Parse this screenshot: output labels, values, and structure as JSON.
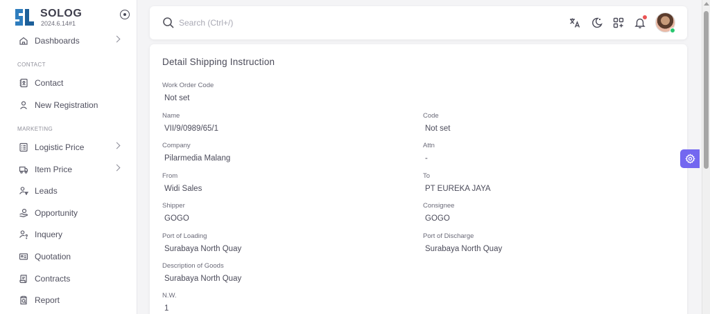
{
  "brand": {
    "name": "SOLOG",
    "version": "2024.6.14#1",
    "logo_text": "SL"
  },
  "sidebar": {
    "items": [
      {
        "key": "dashboards",
        "label": "Dashboards",
        "icon": "home-icon",
        "has_submenu": true
      },
      {
        "key": "contact",
        "label": "Contact",
        "icon": "contact-book-icon",
        "has_submenu": false
      },
      {
        "key": "new-registration",
        "label": "New Registration",
        "icon": "user-icon",
        "has_submenu": false
      },
      {
        "key": "logistic-price",
        "label": "Logistic Price",
        "icon": "list-icon",
        "has_submenu": true
      },
      {
        "key": "item-price",
        "label": "Item Price",
        "icon": "truck-icon",
        "has_submenu": true
      },
      {
        "key": "leads",
        "label": "Leads",
        "icon": "user-filter-icon",
        "has_submenu": false
      },
      {
        "key": "opportunity",
        "label": "Opportunity",
        "icon": "hand-coin-icon",
        "has_submenu": false
      },
      {
        "key": "inquery",
        "label": "Inquery",
        "icon": "user-question-icon",
        "has_submenu": false
      },
      {
        "key": "quotation",
        "label": "Quotation",
        "icon": "id-card-icon",
        "has_submenu": false
      },
      {
        "key": "contracts",
        "label": "Contracts",
        "icon": "scroll-icon",
        "has_submenu": false
      },
      {
        "key": "report",
        "label": "Report",
        "icon": "report-icon",
        "has_submenu": false
      }
    ],
    "sections": {
      "contact": "CONTACT",
      "marketing": "MARKETING"
    }
  },
  "header": {
    "search_placeholder": "Search (Ctrl+/)",
    "icons": [
      "translate-icon",
      "moon-icon",
      "apps-add-icon",
      "bell-icon"
    ]
  },
  "detail": {
    "title": "Detail Shipping Instruction",
    "fields": {
      "work_order_code": {
        "label": "Work Order Code",
        "value": "Not set"
      },
      "name": {
        "label": "Name",
        "value": "VII/9/0989/65/1"
      },
      "code": {
        "label": "Code",
        "value": "Not set"
      },
      "company": {
        "label": "Company",
        "value": "Pilarmedia Malang"
      },
      "attn": {
        "label": "Attn",
        "value": "-"
      },
      "from": {
        "label": "From",
        "value": "Widi Sales"
      },
      "to": {
        "label": "To",
        "value": "PT EUREKA JAYA"
      },
      "shipper": {
        "label": "Shipper",
        "value": "GOGO"
      },
      "consignee": {
        "label": "Consignee",
        "value": "GOGO"
      },
      "port_of_loading": {
        "label": "Port of Loading",
        "value": "Surabaya North Quay"
      },
      "port_of_discharge": {
        "label": "Port of Discharge",
        "value": "Surabaya North Quay"
      },
      "description_of_goods": {
        "label": "Description of Goods",
        "value": "Surabaya North Quay"
      },
      "nw": {
        "label": "N.W.",
        "value": "1"
      }
    }
  },
  "colors": {
    "accent": "#7367f0",
    "online": "#28c76f",
    "notification": "#ea5455"
  }
}
